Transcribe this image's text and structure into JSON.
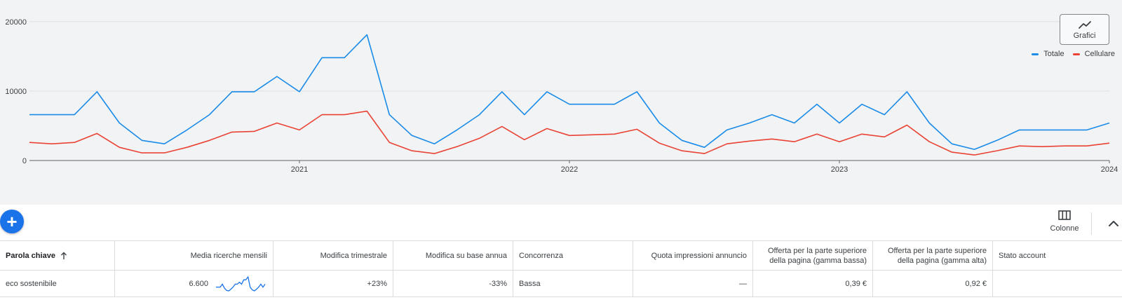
{
  "chart_data": {
    "type": "line",
    "x": [
      "2020-01",
      "2020-02",
      "2020-03",
      "2020-04",
      "2020-05",
      "2020-06",
      "2020-07",
      "2020-08",
      "2020-09",
      "2020-10",
      "2020-11",
      "2020-12",
      "2021-01",
      "2021-02",
      "2021-03",
      "2021-04",
      "2021-05",
      "2021-06",
      "2021-07",
      "2021-08",
      "2021-09",
      "2021-10",
      "2021-11",
      "2021-12",
      "2022-01",
      "2022-02",
      "2022-03",
      "2022-04",
      "2022-05",
      "2022-06",
      "2022-07",
      "2022-08",
      "2022-09",
      "2022-10",
      "2022-11",
      "2022-12",
      "2023-01",
      "2023-02",
      "2023-03",
      "2023-04",
      "2023-05",
      "2023-06",
      "2023-07",
      "2023-08",
      "2023-09",
      "2023-10",
      "2023-11",
      "2023-12",
      "2024-01"
    ],
    "series": [
      {
        "name": "Totale",
        "color": "#1a8be8",
        "values": [
          6600,
          6600,
          6600,
          9900,
          5400,
          2900,
          2400,
          4400,
          6600,
          9900,
          9900,
          12100,
          9900,
          14800,
          14800,
          18100,
          6600,
          3600,
          2400,
          4400,
          6600,
          9900,
          6600,
          9900,
          8100,
          8100,
          8100,
          9900,
          5400,
          2900,
          1900,
          4400,
          5400,
          6600,
          5400,
          8100,
          5400,
          8100,
          6600,
          9900,
          5400,
          2400,
          1600,
          2900,
          4400,
          4400,
          4400,
          4400,
          5400
        ]
      },
      {
        "name": "Cellulare",
        "color": "#ea4335",
        "values": [
          2600,
          2400,
          2600,
          3900,
          1900,
          1100,
          1100,
          1900,
          2900,
          4100,
          4200,
          5400,
          4400,
          6600,
          6600,
          7100,
          2600,
          1400,
          1000,
          2000,
          3200,
          4900,
          3000,
          4600,
          3600,
          3700,
          3800,
          4500,
          2500,
          1400,
          1000,
          2400,
          2800,
          3100,
          2700,
          3800,
          2700,
          3800,
          3400,
          5100,
          2700,
          1200,
          800,
          1400,
          2100,
          2000,
          2100,
          2100,
          2500
        ]
      }
    ],
    "yticks": [
      "0",
      "10000",
      "20000"
    ],
    "xticks": [
      {
        "label": "2021",
        "x": "2021-01"
      },
      {
        "label": "2022",
        "x": "2022-01"
      },
      {
        "label": "2023",
        "x": "2023-01"
      },
      {
        "label": "2024",
        "x": "2024-01"
      }
    ],
    "ylim": [
      0,
      22000
    ],
    "grid": true,
    "legend_position": "top-right"
  },
  "toolbar": {
    "charts_label": "Grafici",
    "charts_icon": "trend-line-icon",
    "columns_label": "Colonne",
    "columns_icon": "columns-icon",
    "add_icon": "plus-icon",
    "add_symbol": "+",
    "collapse_icon": "chevron-up-icon"
  },
  "table": {
    "headers": [
      "Parola chiave",
      "Media ricerche mensili",
      "Modifica trimestrale",
      "Modifica su base annua",
      "Concorrenza",
      "Quota impressioni annuncio",
      "Offerta per la parte superiore della pagina (gamma bassa)",
      "Offerta per la parte superiore della pagina (gamma alta)",
      "Stato account"
    ],
    "rows": [
      {
        "keyword": "eco sostenibile",
        "avg_searches": "6.600",
        "trend": [
          6600,
          6600,
          6600,
          9900,
          5400,
          2900,
          2400,
          4400,
          6600,
          9900,
          9900,
          12100,
          9900,
          14800,
          14800,
          18100,
          6600,
          3600,
          2400,
          4400,
          6600,
          9900,
          6600,
          9900
        ],
        "three_month_change": "+23%",
        "yoy_change": "-33%",
        "competition": "Bassa",
        "impression_share": "—",
        "bid_low": "0,39 €",
        "bid_high": "0,92 €",
        "account_status": ""
      }
    ]
  },
  "colors": {
    "accent": "#1a73e8",
    "chart_bg": "#f1f3f4",
    "totale": "#1a8be8",
    "cellulare": "#ea4335"
  }
}
